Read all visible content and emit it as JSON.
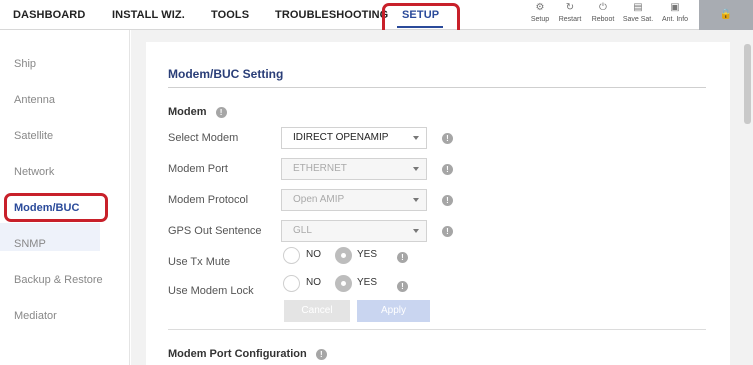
{
  "nav": {
    "items": [
      "DASHBOARD",
      "INSTALL WIZ.",
      "TOOLS",
      "TROUBLESHOOTING",
      "SETUP"
    ],
    "active": "SETUP"
  },
  "toolbar": {
    "setup": "Setup",
    "restart": "Restart",
    "reboot": "Reboot",
    "save_sat": "Save Sat.",
    "ant_info": "Ant. Info"
  },
  "sidebar": {
    "items": [
      "Ship",
      "Antenna",
      "Satellite",
      "Network",
      "Modem/BUC",
      "SNMP",
      "Backup & Restore",
      "Mediator"
    ],
    "active": "Modem/BUC"
  },
  "card": {
    "title": "Modem/BUC Setting",
    "modem_section": "Modem",
    "port_section": "Modem Port Configuration"
  },
  "fields": {
    "select_modem": {
      "label": "Select Modem",
      "value": "IDIRECT OPENAMIP"
    },
    "modem_port": {
      "label": "Modem Port",
      "value": "ETHERNET"
    },
    "modem_protocol": {
      "label": "Modem Protocol",
      "value": "Open AMIP"
    },
    "gps_out": {
      "label": "GPS Out Sentence",
      "value": "GLL"
    },
    "tx_mute": {
      "label": "Use Tx Mute",
      "no": "NO",
      "yes": "YES",
      "selected": "YES"
    },
    "modem_lock": {
      "label": "Use Modem Lock",
      "no": "NO",
      "yes": "YES",
      "selected": "YES"
    }
  },
  "buttons": {
    "cancel": "Cancel",
    "apply": "Apply"
  },
  "icons": {
    "info": "!",
    "setup": "gear-icon",
    "restart": "restart-icon",
    "reboot": "power-icon",
    "save": "save-icon",
    "ant_info": "antenna-info-icon",
    "lock": "lock-icon"
  },
  "colors": {
    "accent": "#2a4a9a",
    "highlight": "#c8202a",
    "apply_bg": "#c9d5f0"
  }
}
